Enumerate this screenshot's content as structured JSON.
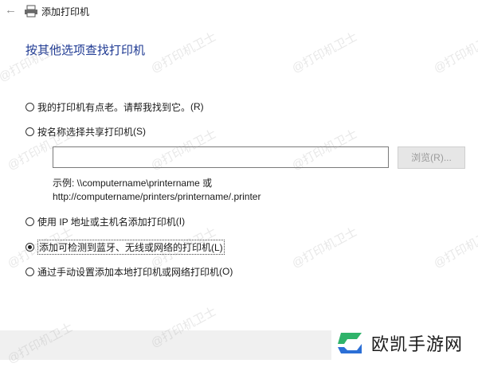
{
  "window": {
    "title": "添加打印机"
  },
  "heading": "按其他选项查找打印机",
  "options": [
    {
      "label": "我的打印机有点老。请帮我找到它。",
      "key": "(R)",
      "checked": false
    },
    {
      "label": "按名称选择共享打印机",
      "key": "(S)",
      "checked": false
    },
    {
      "label": "使用 IP 地址或主机名添加打印机",
      "key": "(I)",
      "checked": false
    },
    {
      "label": "添加可检测到蓝牙、无线或网络的打印机",
      "key": "(L)",
      "checked": true
    },
    {
      "label": "通过手动设置添加本地打印机或网络打印机",
      "key": "(O)",
      "checked": false
    }
  ],
  "share_input": {
    "value": ""
  },
  "browse_label": "浏览(R)...",
  "example": {
    "line1": "示例: \\\\computername\\printername 或",
    "line2": "http://computername/printers/printername/.printer"
  },
  "watermark_text": "@打印机卫士",
  "brand": {
    "name": "欧凯手游网",
    "colors": {
      "green": "#2fb36a",
      "blue": "#2b6fd6"
    }
  }
}
